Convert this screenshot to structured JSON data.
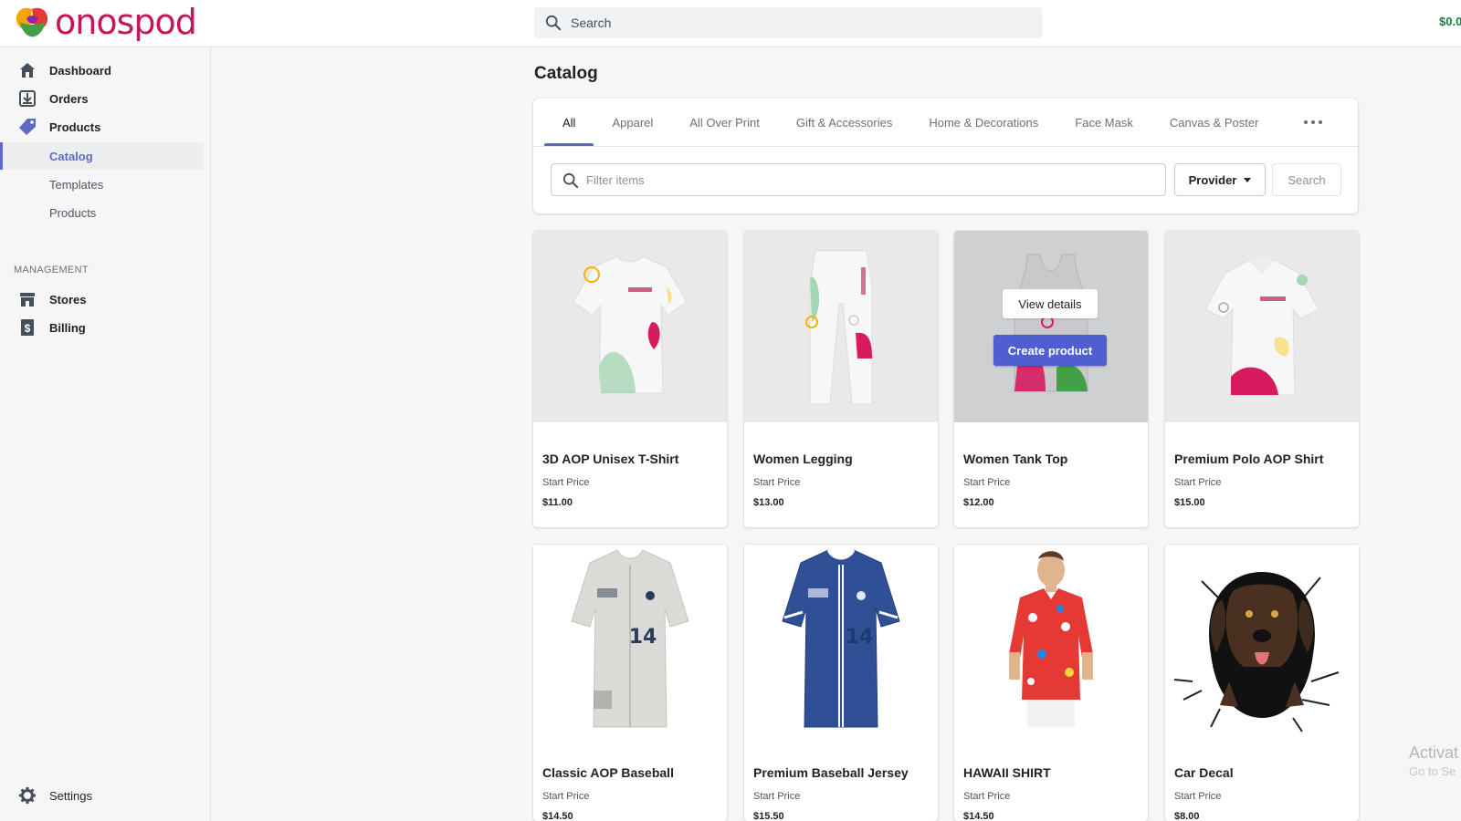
{
  "brand": {
    "name": "onospod"
  },
  "topbar": {
    "search_placeholder": "Search",
    "balance": "$0.0"
  },
  "sidebar": {
    "items": [
      {
        "label": "Dashboard",
        "icon": "home-icon"
      },
      {
        "label": "Orders",
        "icon": "download-icon"
      },
      {
        "label": "Products",
        "icon": "tag-icon"
      }
    ],
    "sub_items": [
      {
        "label": "Catalog",
        "active": true
      },
      {
        "label": "Templates",
        "active": false
      },
      {
        "label": "Products",
        "active": false
      }
    ],
    "management_label": "MANAGEMENT",
    "management_items": [
      {
        "label": "Stores",
        "icon": "store-icon"
      },
      {
        "label": "Billing",
        "icon": "billing-icon"
      }
    ],
    "settings_label": "Settings"
  },
  "main": {
    "title": "Catalog",
    "tabs": [
      "All",
      "Apparel",
      "All Over Print",
      "Gift & Accessories",
      "Home & Decorations",
      "Face Mask",
      "Canvas & Poster"
    ],
    "active_tab": "All",
    "filter_placeholder": "Filter items",
    "provider_label": "Provider",
    "search_label": "Search"
  },
  "products": [
    {
      "name": "3D AOP Unisex T-Shirt",
      "price_label": "Start Price",
      "price": "$11.00"
    },
    {
      "name": "Women Legging",
      "price_label": "Start Price",
      "price": "$13.00"
    },
    {
      "name": "Women Tank Top",
      "price_label": "Start Price",
      "price": "$12.00"
    },
    {
      "name": "Premium Polo AOP Shirt",
      "price_label": "Start Price",
      "price": "$15.00"
    },
    {
      "name": "Classic AOP Baseball",
      "price_label": "Start Price",
      "price": "$14.50"
    },
    {
      "name": "Premium Baseball Jersey",
      "price_label": "Start Price",
      "price": "$15.50"
    },
    {
      "name": "HAWAII SHIRT",
      "price_label": "Start Price",
      "price": "$14.50"
    },
    {
      "name": "Car Decal",
      "price_label": "Start Price",
      "price": "$8.00"
    }
  ],
  "hover_card": {
    "view_details": "View details",
    "create_product": "Create product"
  },
  "watermark": {
    "line1": "Activat",
    "line2": "Go to Se"
  },
  "colors": {
    "accent": "#5c6ac4",
    "primary_button": "#4f5ed1",
    "brand": "#c2185b",
    "balance": "#108043"
  }
}
